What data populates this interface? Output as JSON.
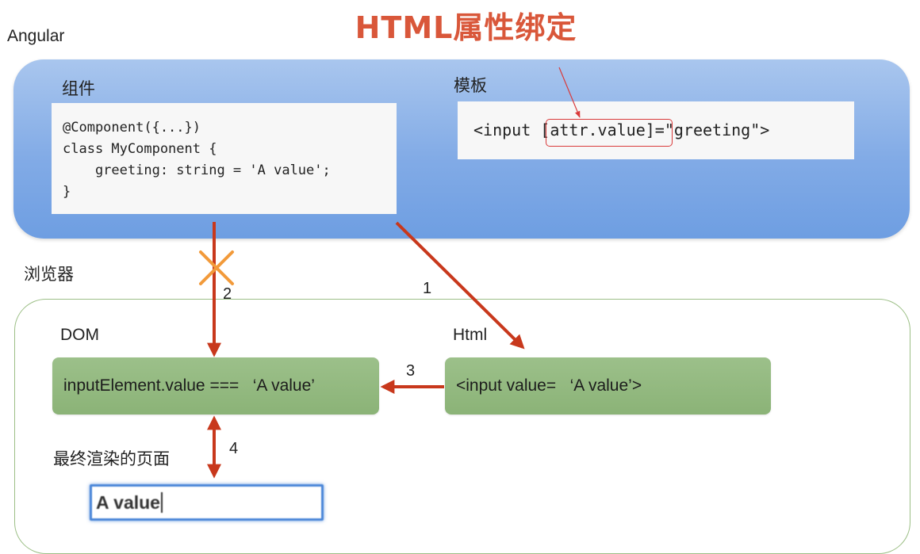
{
  "title": "HTML属性绑定",
  "angular_label": "Angular",
  "component": {
    "label": "组件",
    "code_lines": [
      "@Component({...})",
      "class MyComponent {",
      "    greeting: string = 'A value';",
      "}"
    ]
  },
  "template": {
    "label": "模板",
    "code": "<input [attr.value]=\"greeting\">",
    "highlight": "[attr.value]"
  },
  "browser_label": "浏览器",
  "dom": {
    "label": "DOM",
    "text": "inputElement.value ===   ‘A value’"
  },
  "html": {
    "label": "Html",
    "text": "<input value=   ‘A value’>"
  },
  "rendered_label": "最终渲染的页面",
  "rendered_input_value": "A value",
  "steps": [
    "1",
    "2",
    "3",
    "4"
  ],
  "colors": {
    "title": "#d9573a",
    "arrow": "#c8381c",
    "cross": "#f29a3a",
    "panel_blue": "#82abe6",
    "green_box": "#8bb377",
    "highlight": "#d93a3a"
  }
}
